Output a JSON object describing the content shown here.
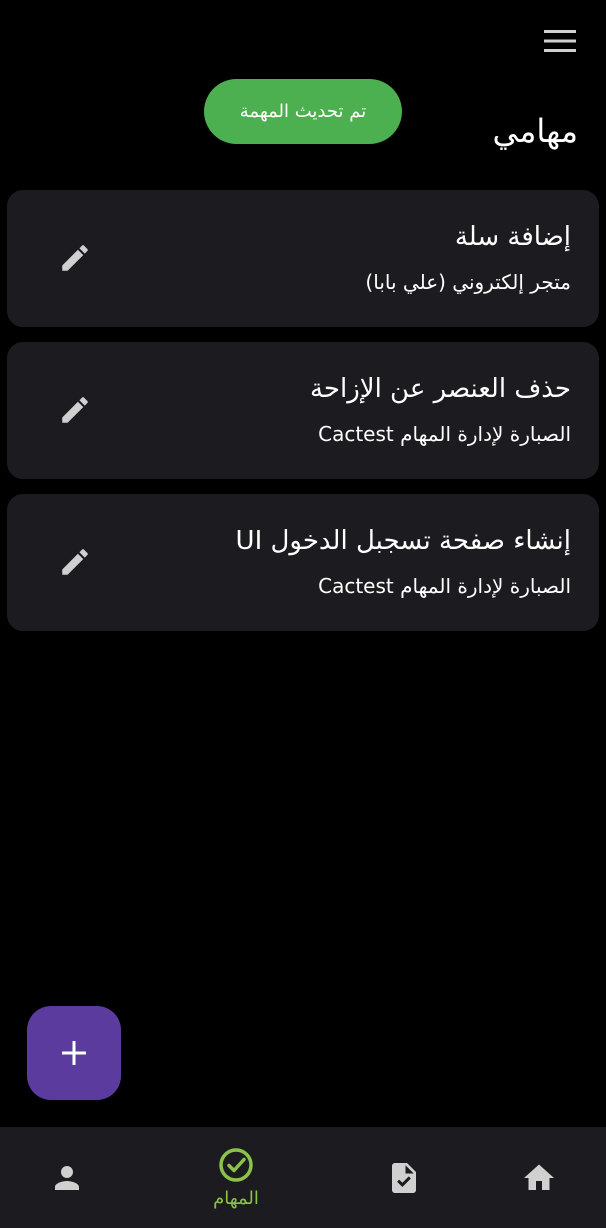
{
  "header": {
    "title": "مهامي",
    "menu_icon": "menu-icon"
  },
  "toast": {
    "message": "تم تحديث المهمة",
    "color": "#4caf50"
  },
  "tasks": [
    {
      "title": "إضافة سلة",
      "subtitle": "متجر إلكتروني (علي بابا)",
      "action_icon": "edit-icon"
    },
    {
      "title": "حذف العنصر عن الإزاحة",
      "subtitle": "الصبارة لإدارة المهام Cactest",
      "action_icon": "edit-icon"
    },
    {
      "title": "إنشاء صفحة تسجبل الدخول UI",
      "subtitle": "الصبارة لإدارة المهام Cactest",
      "action_icon": "edit-icon"
    }
  ],
  "fab": {
    "icon": "plus-icon",
    "color": "#5b3c9e"
  },
  "bottom_nav": {
    "items": [
      {
        "icon": "home-icon",
        "label": ""
      },
      {
        "icon": "task-document-icon",
        "label": ""
      },
      {
        "icon": "check-circle-icon",
        "label": "المهام",
        "active": true
      },
      {
        "icon": "person-icon",
        "label": ""
      }
    ],
    "active_color": "#8bc34a"
  },
  "colors": {
    "background": "#000000",
    "card": "#1c1b1f",
    "icon": "#d0d0d0"
  }
}
